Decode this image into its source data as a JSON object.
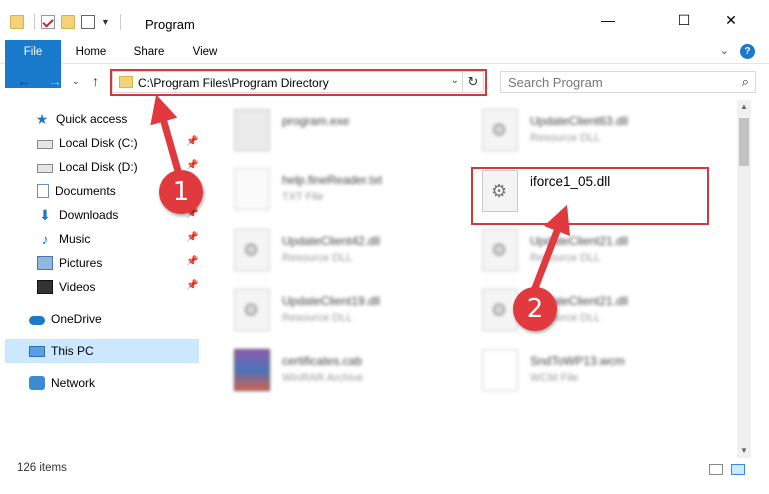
{
  "window": {
    "title": "Program"
  },
  "ribbon": {
    "tabs": [
      "File",
      "Home",
      "Share",
      "View"
    ]
  },
  "address": {
    "path": "C:\\Program Files\\Program Directory"
  },
  "search": {
    "placeholder": "Search Program"
  },
  "sidebar": {
    "items": [
      {
        "label": "Quick access",
        "icon": "star-icon"
      },
      {
        "label": "Local Disk (C:)",
        "icon": "drive-icon",
        "pinned": true
      },
      {
        "label": "Local Disk (D:)",
        "icon": "drive-icon",
        "pinned": true
      },
      {
        "label": "Documents",
        "icon": "documents-icon",
        "pinned": true
      },
      {
        "label": "Downloads",
        "icon": "download-icon",
        "pinned": true
      },
      {
        "label": "Music",
        "icon": "music-icon",
        "pinned": true
      },
      {
        "label": "Pictures",
        "icon": "pictures-icon",
        "pinned": true
      },
      {
        "label": "Videos",
        "icon": "videos-icon",
        "pinned": true
      },
      {
        "label": "OneDrive",
        "icon": "cloud-icon"
      },
      {
        "label": "This PC",
        "icon": "pc-icon",
        "selected": true
      },
      {
        "label": "Network",
        "icon": "network-icon"
      }
    ]
  },
  "files": [
    {
      "name": "program.exe",
      "type": "",
      "icon": "exe-icon",
      "blurred": true
    },
    {
      "name": "UpdateClient63.dll",
      "type": "Resource DLL",
      "icon": "dll-icon",
      "blurred": true
    },
    {
      "name": "help.fineReader.txt",
      "type": "TXT File",
      "icon": "txt-icon",
      "blurred": true
    },
    {
      "name": "iforce1_05.dll",
      "type": "",
      "icon": "dll-icon",
      "blurred": false
    },
    {
      "name": "UpdateClient42.dll",
      "type": "Resource DLL",
      "icon": "dll-icon",
      "blurred": true
    },
    {
      "name": "UpdateClient21.dll",
      "type": "Resource DLL",
      "icon": "dll-icon",
      "blurred": true
    },
    {
      "name": "UpdateClient19.dll",
      "type": "Resource DLL",
      "icon": "dll-icon",
      "blurred": true
    },
    {
      "name": "UpdateClient21.dll",
      "type": "Resource DLL",
      "icon": "dll-icon",
      "blurred": true
    },
    {
      "name": "certificates.cab",
      "type": "WinRAR Archive",
      "icon": "rar-icon",
      "blurred": true
    },
    {
      "name": "SndToWP13.wcm",
      "type": "WCM File",
      "icon": "wcm-icon",
      "blurred": true
    }
  ],
  "status": {
    "item_count": "126 items"
  },
  "annotations": {
    "step1": "1",
    "step2": "2",
    "color": "#e0393e"
  },
  "colors": {
    "accent": "#1979ca",
    "highlight": "#d0393e",
    "selected": "#cce8ff"
  }
}
